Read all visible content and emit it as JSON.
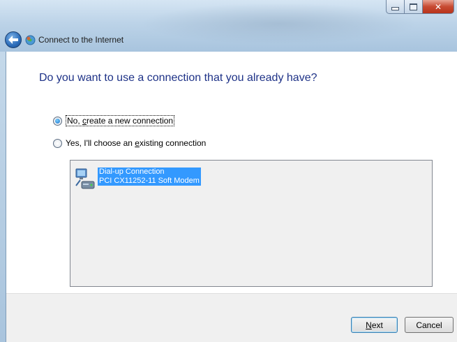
{
  "window": {
    "title": "Connect to the Internet"
  },
  "heading": "Do you want to use a connection that you already have?",
  "options": [
    {
      "pre": "No, ",
      "mnemonic": "c",
      "post": "reate a new connection",
      "checked": true
    },
    {
      "pre": "Yes, I'll choose an ",
      "mnemonic": "e",
      "post": "xisting connection",
      "checked": false
    }
  ],
  "connections": [
    {
      "name": "Dial-up Connection",
      "device": "PCI CX11252-11 Soft Modem",
      "icon": "dialup-modem-icon",
      "selected": true
    }
  ],
  "buttons": {
    "next_mnemonic": "N",
    "next_rest": "ext",
    "cancel": "Cancel"
  },
  "colors": {
    "heading": "#1e3287",
    "selection": "#3399ff"
  }
}
